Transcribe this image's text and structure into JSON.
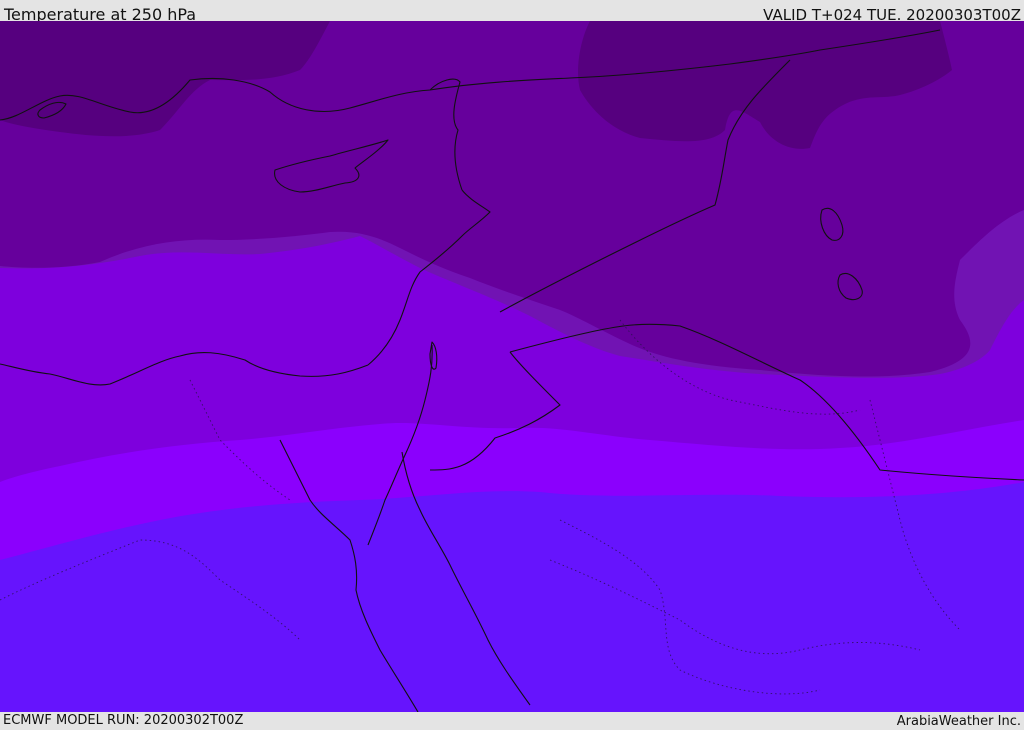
{
  "header": {
    "title": "Temperature at 250 hPa",
    "valid": "VALID T+024 TUE. 20200303T00Z"
  },
  "footer": {
    "model_run": "ECMWF MODEL RUN: 20200302T00Z",
    "credit": "ArabiaWeather Inc."
  },
  "map": {
    "region": "Eastern Mediterranean, Levant, Northern Red Sea",
    "colors": {
      "band_darkest": "#56007f",
      "band_dark": "#66009c",
      "band_mid": "#7113b3",
      "band_violet": "#7e00dd",
      "band_bright": "#8b00fd",
      "band_blue": "#6614fd",
      "coastline": "#111111"
    }
  }
}
